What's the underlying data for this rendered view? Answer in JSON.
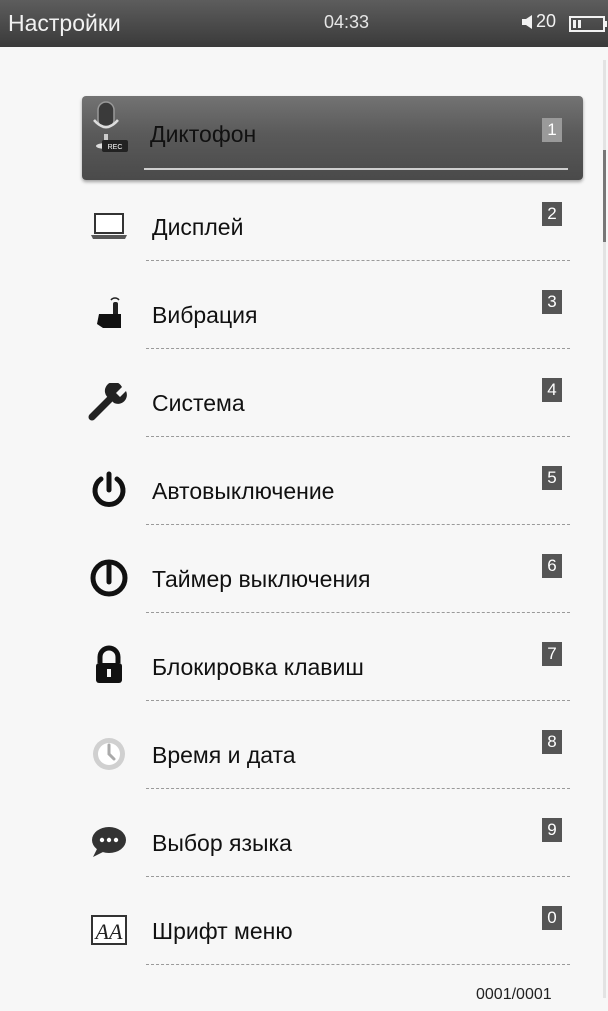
{
  "status_bar": {
    "title": "Настройки",
    "time": "04:33",
    "volume": "20",
    "volume_icon": "speaker-icon",
    "battery_icon": "battery-icon"
  },
  "menu": {
    "items": [
      {
        "label": "Диктофон",
        "num": "1",
        "icon": "microphone-rec-icon",
        "selected": true
      },
      {
        "label": "Дисплей",
        "num": "2",
        "icon": "laptop-display-icon"
      },
      {
        "label": "Вибрация",
        "num": "3",
        "icon": "hand-touch-icon"
      },
      {
        "label": "Система",
        "num": "4",
        "icon": "wrench-icon"
      },
      {
        "label": "Автовыключение",
        "num": "5",
        "icon": "power-icon"
      },
      {
        "label": "Таймер выключения",
        "num": "6",
        "icon": "power-timer-icon"
      },
      {
        "label": "Блокировка клавиш",
        "num": "7",
        "icon": "lock-icon"
      },
      {
        "label": "Время и дата",
        "num": "8",
        "icon": "clock-icon"
      },
      {
        "label": "Выбор языка",
        "num": "9",
        "icon": "speech-bubble-icon"
      },
      {
        "label": "Шрифт меню",
        "num": "0",
        "icon": "font-icon"
      }
    ]
  },
  "pager": "0001/0001"
}
